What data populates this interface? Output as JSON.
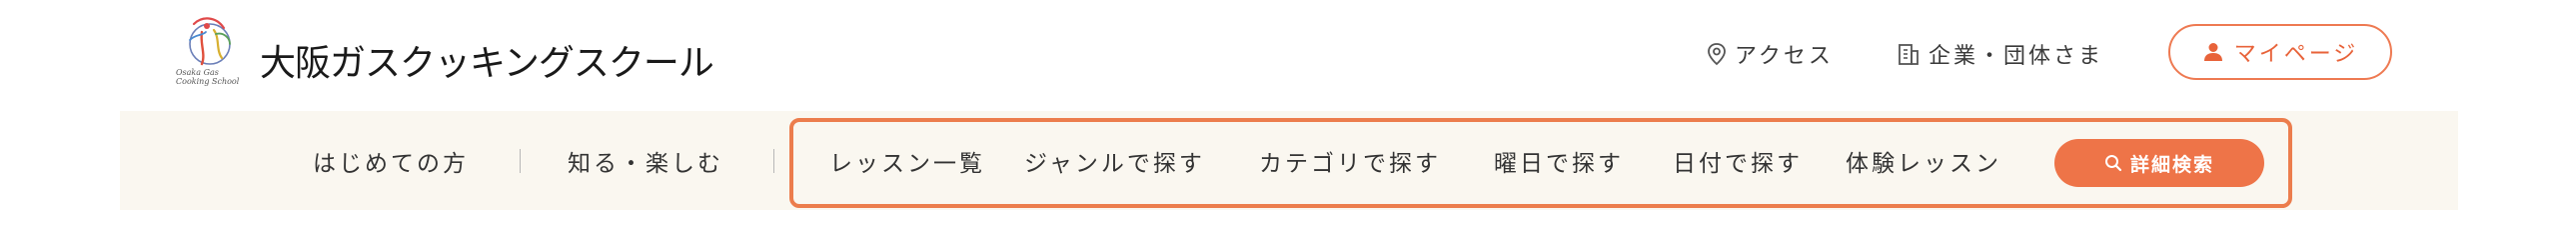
{
  "header": {
    "logo": {
      "name": "大阪ガスクッキングスクール",
      "script_line1": "Osaka Gas",
      "script_line2": "Cooking School"
    },
    "access_label": "アクセス",
    "corporate_label": "企業・団体さま",
    "mypage_label": "マイページ"
  },
  "nav": {
    "primary": [
      {
        "label": "はじめての方"
      },
      {
        "label": "知る・楽しむ"
      }
    ],
    "secondary": [
      {
        "label": "レッスン一覧"
      },
      {
        "label": "ジャンルで探す"
      },
      {
        "label": "カテゴリで探す"
      },
      {
        "label": "曜日で探す"
      },
      {
        "label": "日付で探す"
      },
      {
        "label": "体験レッスン"
      }
    ],
    "search_label": "詳細検索"
  },
  "colors": {
    "accent": "#ee7448",
    "nav_background": "#faf7f0",
    "highlight_border": "#ec7d4d"
  },
  "icons": {
    "access": "map-pin-icon",
    "corporate": "building-icon",
    "mypage": "user-icon",
    "search": "search-icon"
  }
}
